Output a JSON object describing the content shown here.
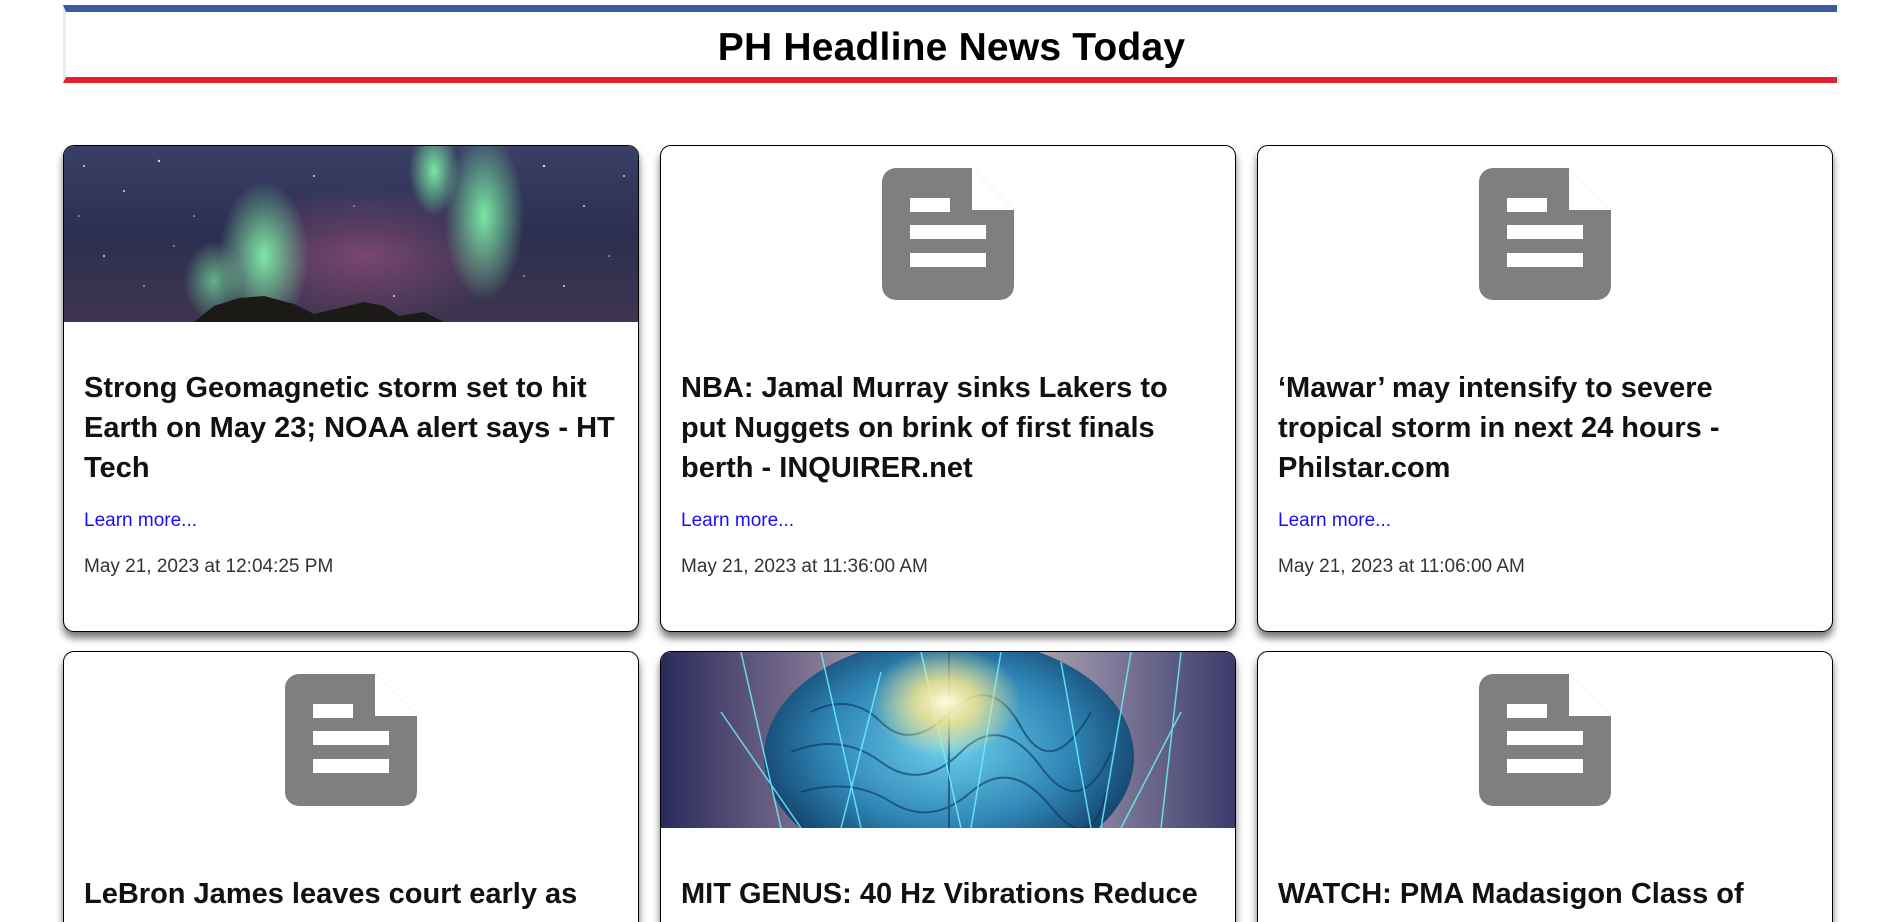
{
  "header": {
    "title": "PH Headline News Today",
    "accent_top": "#3b5ba5",
    "accent_bottom": "#e3202b"
  },
  "articles": [
    {
      "thumbnail": "aurora-photo",
      "title": "Strong Geomagnetic storm set to hit Earth on May 23; NOAA alert says - HT Tech",
      "link_label": "Learn more...",
      "date": "May 21, 2023 at 12:04:25 PM"
    },
    {
      "thumbnail": "document-icon",
      "title": "NBA: Jamal Murray sinks Lakers to put Nuggets on brink of first finals berth - INQUIRER.net",
      "link_label": "Learn more...",
      "date": "May 21, 2023 at 11:36:00 AM"
    },
    {
      "thumbnail": "document-icon",
      "title": "‘Mawar’ may intensify to severe tropical storm in next 24 hours - Philstar.com",
      "link_label": "Learn more...",
      "date": "May 21, 2023 at 11:06:00 AM"
    },
    {
      "thumbnail": "document-icon",
      "title": "LeBron James leaves court early as"
    },
    {
      "thumbnail": "brain-photo",
      "title": "MIT GENUS: 40 Hz Vibrations Reduce"
    },
    {
      "thumbnail": "document-icon",
      "title": "WATCH: PMA Madasigon Class of"
    }
  ]
}
